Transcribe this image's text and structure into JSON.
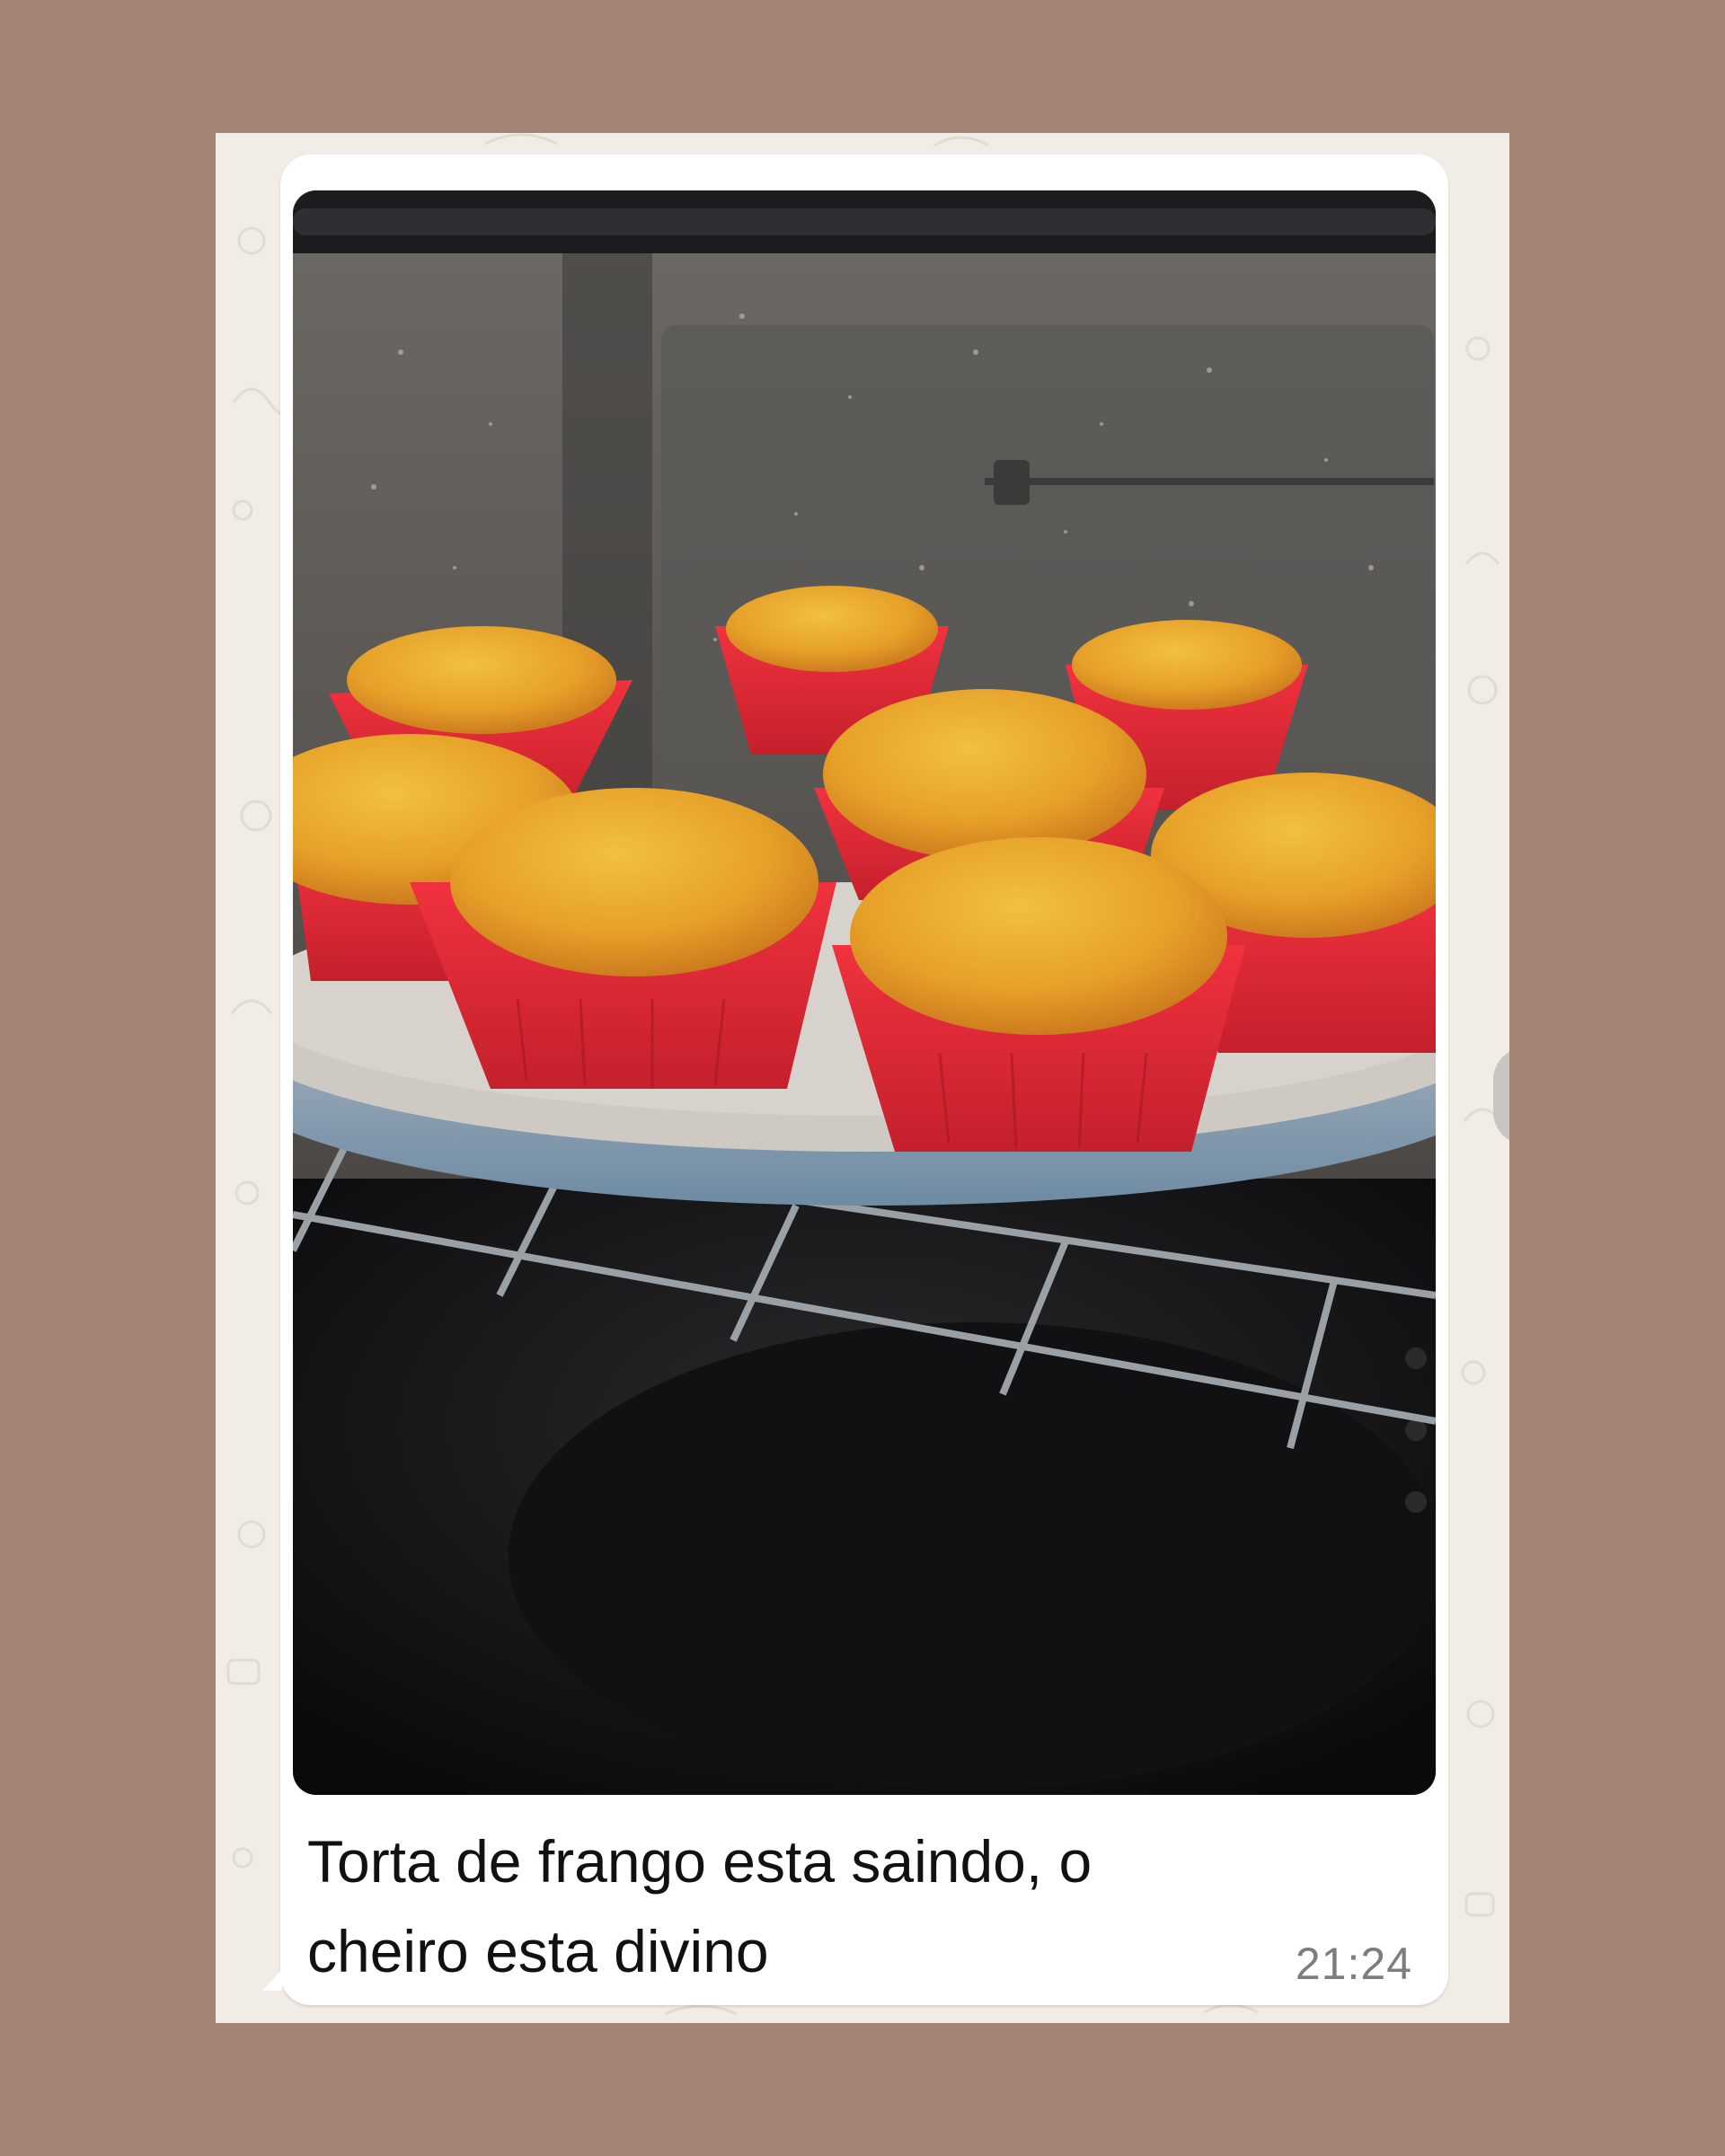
{
  "message": {
    "caption": "Torta de frango esta saindo, o cheiro esta divino",
    "caption_line1": "Torta de frango esta saindo, o",
    "caption_line2": "cheiro esta divino",
    "time": "21:24",
    "photo_icon": "muffins-in-oven-photo"
  },
  "colors": {
    "page_background": "#a48475",
    "chat_background": "#f1ede6",
    "bubble": "#ffffff",
    "muffin_cups": "#e8303c",
    "muffins": "#e39a2a"
  }
}
